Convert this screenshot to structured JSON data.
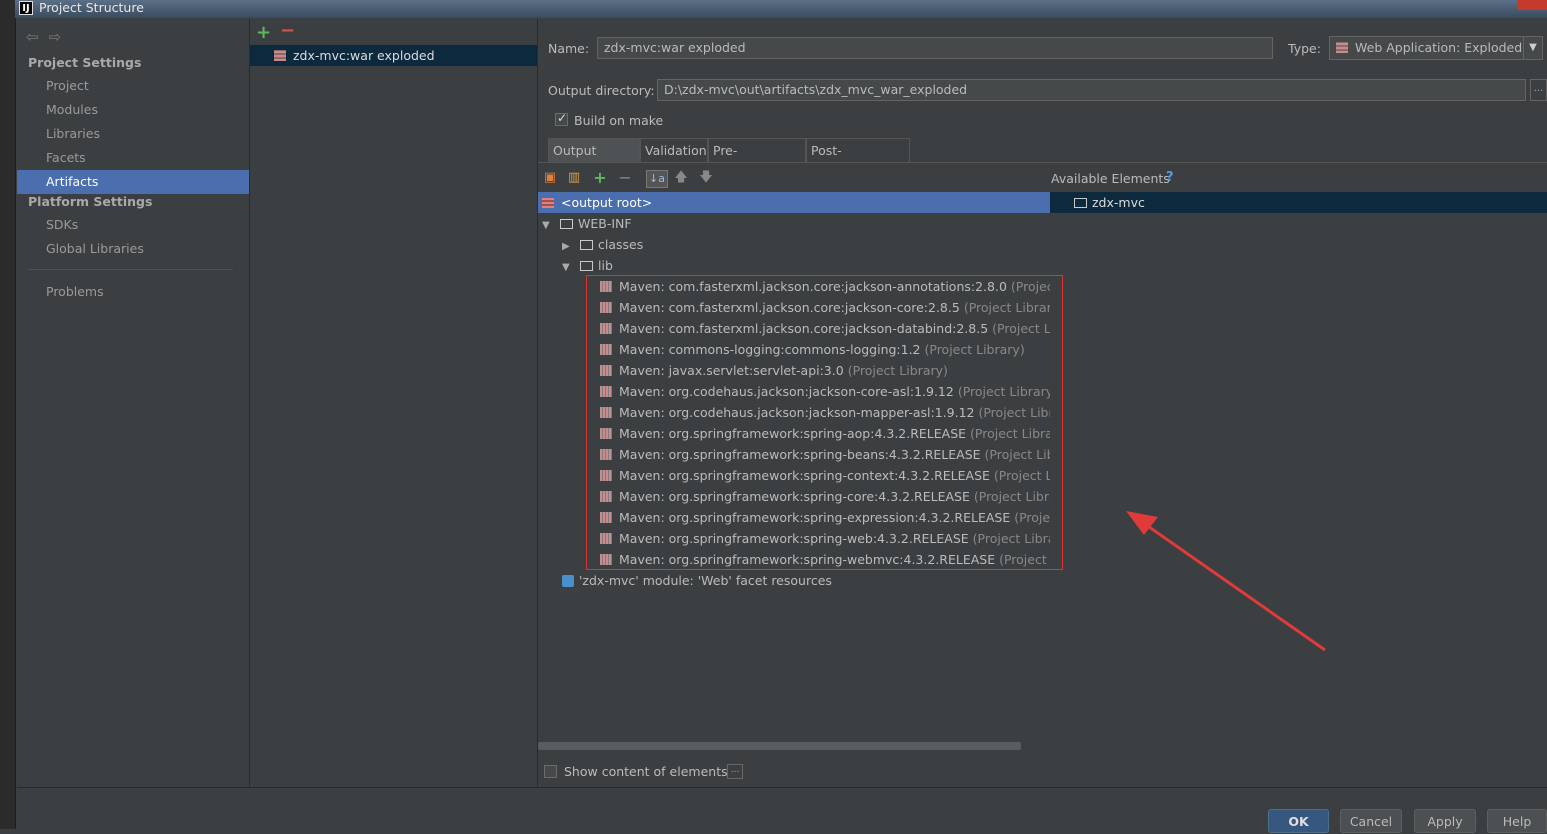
{
  "window": {
    "title": "Project Structure",
    "app_icon": "IJ"
  },
  "nav": {
    "back": "⇦",
    "forward": "⇨"
  },
  "sidebar": {
    "project_settings_header": "Project Settings",
    "project_items": [
      {
        "label": "Project",
        "selected": false
      },
      {
        "label": "Modules",
        "selected": false
      },
      {
        "label": "Libraries",
        "selected": false
      },
      {
        "label": "Facets",
        "selected": false
      },
      {
        "label": "Artifacts",
        "selected": true
      }
    ],
    "platform_settings_header": "Platform Settings",
    "platform_items": [
      {
        "label": "SDKs"
      },
      {
        "label": "Global Libraries"
      }
    ],
    "problems": "Problems"
  },
  "artifacts": {
    "add": "+",
    "remove": "−",
    "items": [
      "zdx-mvc:war exploded"
    ]
  },
  "editor": {
    "name_label": "Name:",
    "name_value": "zdx-mvc:war exploded",
    "type_label": "Type:",
    "type_value": "Web Application: Exploded",
    "output_dir_label": "Output directory:",
    "output_dir_value": "D:\\zdx-mvc\\out\\artifacts\\zdx_mvc_war_exploded",
    "browse": "...",
    "build_on_make": "Build on make",
    "build_on_make_checked": true,
    "tabs": [
      "Output Layout",
      "Validation",
      "Pre-processing",
      "Post-processing"
    ],
    "active_tab": "Output Layout",
    "available_elements_label": "Available Elements",
    "help_mark": "?"
  },
  "tree": {
    "root": "<output root>",
    "web_inf": "WEB-INF",
    "classes": "classes",
    "lib": "lib",
    "libraries": [
      {
        "name": "Maven: com.fasterxml.jackson.core:jackson-annotations:2.8.0",
        "suffix": "(Project Libra"
      },
      {
        "name": "Maven: com.fasterxml.jackson.core:jackson-core:2.8.5",
        "suffix": "(Project Library)"
      },
      {
        "name": "Maven: com.fasterxml.jackson.core:jackson-databind:2.8.5",
        "suffix": "(Project Library"
      },
      {
        "name": "Maven: commons-logging:commons-logging:1.2",
        "suffix": "(Project Library)"
      },
      {
        "name": "Maven: javax.servlet:servlet-api:3.0",
        "suffix": "(Project Library)"
      },
      {
        "name": "Maven: org.codehaus.jackson:jackson-core-asl:1.9.12",
        "suffix": "(Project Library)"
      },
      {
        "name": "Maven: org.codehaus.jackson:jackson-mapper-asl:1.9.12",
        "suffix": "(Project Library)"
      },
      {
        "name": "Maven: org.springframework:spring-aop:4.3.2.RELEASE",
        "suffix": "(Project Library)"
      },
      {
        "name": "Maven: org.springframework:spring-beans:4.3.2.RELEASE",
        "suffix": "(Project Library)"
      },
      {
        "name": "Maven: org.springframework:spring-context:4.3.2.RELEASE",
        "suffix": "(Project Library"
      },
      {
        "name": "Maven: org.springframework:spring-core:4.3.2.RELEASE",
        "suffix": "(Project Library)"
      },
      {
        "name": "Maven: org.springframework:spring-expression:4.3.2.RELEASE",
        "suffix": "(Project Lib"
      },
      {
        "name": "Maven: org.springframework:spring-web:4.3.2.RELEASE",
        "suffix": "(Project Library)"
      },
      {
        "name": "Maven: org.springframework:spring-webmvc:4.3.2.RELEASE",
        "suffix": "(Project Librar"
      }
    ],
    "facet_resources": "'zdx-mvc' module: 'Web' facet resources",
    "available": [
      "zdx-mvc"
    ]
  },
  "footer": {
    "show_content": "Show content of elements",
    "show_content_checked": false,
    "more": "...",
    "buttons": {
      "ok": "OK",
      "cancel": "Cancel",
      "apply": "Apply",
      "help": "Help"
    }
  },
  "colors": {
    "background": "#3c3f41",
    "selection": "#4b6eaf",
    "annotation_red": "#e03030"
  }
}
